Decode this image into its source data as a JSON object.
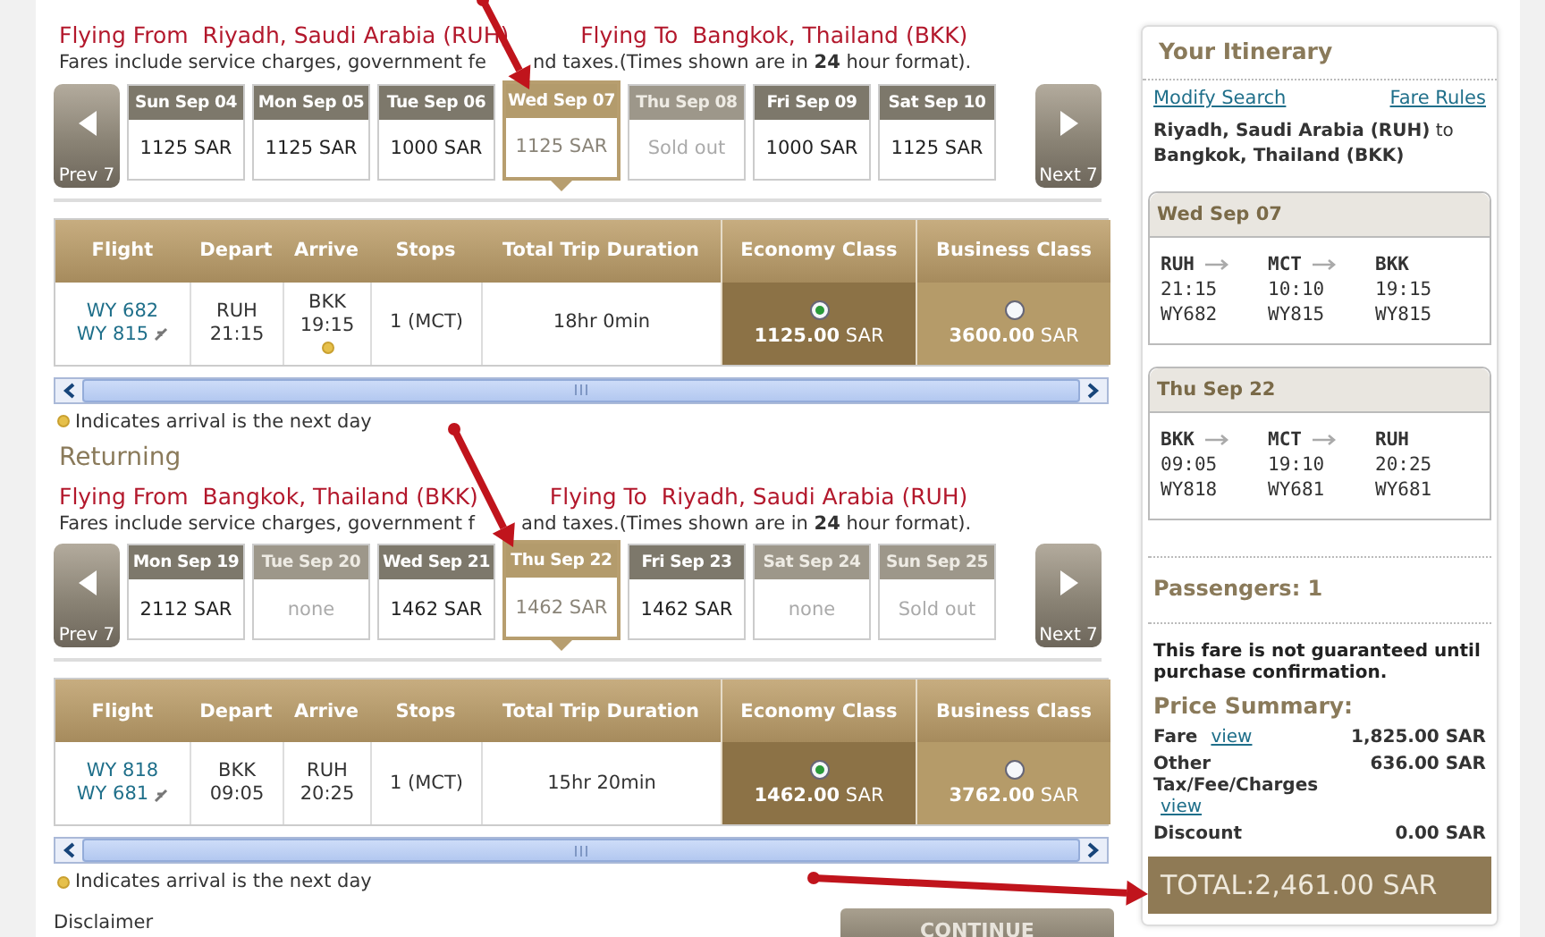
{
  "journeys": [
    {
      "from_label": "Flying From",
      "from": "Riyadh, Saudi Arabia (RUH)",
      "to_label": "Flying To",
      "to": "Bangkok, Thailand (BKK)",
      "note": [
        "Fares include service charges, government fe",
        "nd taxes.(Times shown are in **24** hour format)."
      ],
      "prev": "Prev 7",
      "next": "Next 7",
      "dates": [
        {
          "label": "Sun Sep 04",
          "price": "1125 SAR",
          "selected": false,
          "disabled": false
        },
        {
          "label": "Mon Sep 05",
          "price": "1125 SAR",
          "selected": false,
          "disabled": false
        },
        {
          "label": "Tue Sep 06",
          "price": "1000 SAR",
          "selected": false,
          "disabled": false
        },
        {
          "label": "Wed Sep 07",
          "price": "1125 SAR",
          "selected": true,
          "disabled": false
        },
        {
          "label": "Thu Sep 08",
          "price": "Sold out",
          "selected": false,
          "disabled": true
        },
        {
          "label": "Fri Sep 09",
          "price": "1000 SAR",
          "selected": false,
          "disabled": false
        },
        {
          "label": "Sat Sep 10",
          "price": "1125 SAR",
          "selected": false,
          "disabled": false
        }
      ],
      "columns": [
        "Flight",
        "Depart",
        "Arrive",
        "Stops",
        "Total Trip Duration",
        "Economy Class",
        "Business Class"
      ],
      "row": {
        "flights": [
          "WY 682",
          "WY 815"
        ],
        "depart": [
          "RUH",
          "21:15"
        ],
        "arrive": [
          "BKK",
          "19:15"
        ],
        "next_day": true,
        "stops": "1 (MCT)",
        "duration": "18hr 0min",
        "fares": [
          {
            "amount": "1125.00",
            "currency": "SAR",
            "selected": true
          },
          {
            "amount": "3600.00",
            "currency": "SAR",
            "selected": false
          }
        ]
      },
      "legend": "Indicates arrival is the next day"
    },
    {
      "heading": "Returning",
      "from_label": "Flying From",
      "from": "Bangkok, Thailand (BKK)",
      "to_label": "Flying To",
      "to": "Riyadh, Saudi Arabia (RUH)",
      "note": [
        "Fares include service charges, government f",
        "and taxes.(Times shown are in **24** hour format)."
      ],
      "prev": "Prev 7",
      "next": "Next 7",
      "dates": [
        {
          "label": "Mon Sep 19",
          "price": "2112 SAR",
          "selected": false,
          "disabled": false
        },
        {
          "label": "Tue Sep 20",
          "price": "none",
          "selected": false,
          "disabled": true
        },
        {
          "label": "Wed Sep 21",
          "price": "1462 SAR",
          "selected": false,
          "disabled": false
        },
        {
          "label": "Thu Sep 22",
          "price": "1462 SAR",
          "selected": true,
          "disabled": false
        },
        {
          "label": "Fri Sep 23",
          "price": "1462 SAR",
          "selected": false,
          "disabled": false
        },
        {
          "label": "Sat Sep 24",
          "price": "none",
          "selected": false,
          "disabled": true
        },
        {
          "label": "Sun Sep 25",
          "price": "Sold out",
          "selected": false,
          "disabled": true
        }
      ],
      "columns": [
        "Flight",
        "Depart",
        "Arrive",
        "Stops",
        "Total Trip Duration",
        "Economy Class",
        "Business Class"
      ],
      "row": {
        "flights": [
          "WY 818",
          "WY 681"
        ],
        "depart": [
          "BKK",
          "09:05"
        ],
        "arrive": [
          "RUH",
          "20:25"
        ],
        "next_day": false,
        "stops": "1 (MCT)",
        "duration": "15hr 20min",
        "fares": [
          {
            "amount": "1462.00",
            "currency": "SAR",
            "selected": true
          },
          {
            "amount": "3762.00",
            "currency": "SAR",
            "selected": false
          }
        ]
      },
      "legend": "Indicates arrival is the next day"
    }
  ],
  "disclaimer": "Disclaimer",
  "continue_button": "CONTINUE",
  "itinerary": {
    "title": "Your Itinerary",
    "modify": "Modify Search",
    "rules": "Fare Rules",
    "route": "**Riyadh, Saudi Arabia (RUH)** to **Bangkok, Thailand (BKK)**",
    "legs": [
      {
        "date": "Wed Sep 07",
        "stops": [
          {
            "code": "RUH",
            "time": "21:15",
            "flight": "WY682"
          },
          {
            "code": "MCT",
            "time": "10:10",
            "flight": "WY815"
          },
          {
            "code": "BKK",
            "time": "19:15",
            "flight": "WY815"
          }
        ]
      },
      {
        "date": "Thu Sep 22",
        "stops": [
          {
            "code": "BKK",
            "time": "09:05",
            "flight": "WY818"
          },
          {
            "code": "MCT",
            "time": "19:10",
            "flight": "WY681"
          },
          {
            "code": "RUH",
            "time": "20:25",
            "flight": "WY681"
          }
        ]
      }
    ],
    "passengers": "Passengers: 1",
    "guarantee": "This fare is not guaranteed until purchase confirmation.",
    "summary_title": "Price Summary:",
    "charges": [
      {
        "label": "Fare",
        "link": "view",
        "amount": "1,825.00 SAR"
      },
      {
        "label": "Other Tax/Fee/Charges",
        "link": "view",
        "amount": "636.00 SAR"
      },
      {
        "label": "Discount",
        "amount": "0.00 SAR"
      }
    ],
    "total": "TOTAL:2,461.00 SAR"
  }
}
